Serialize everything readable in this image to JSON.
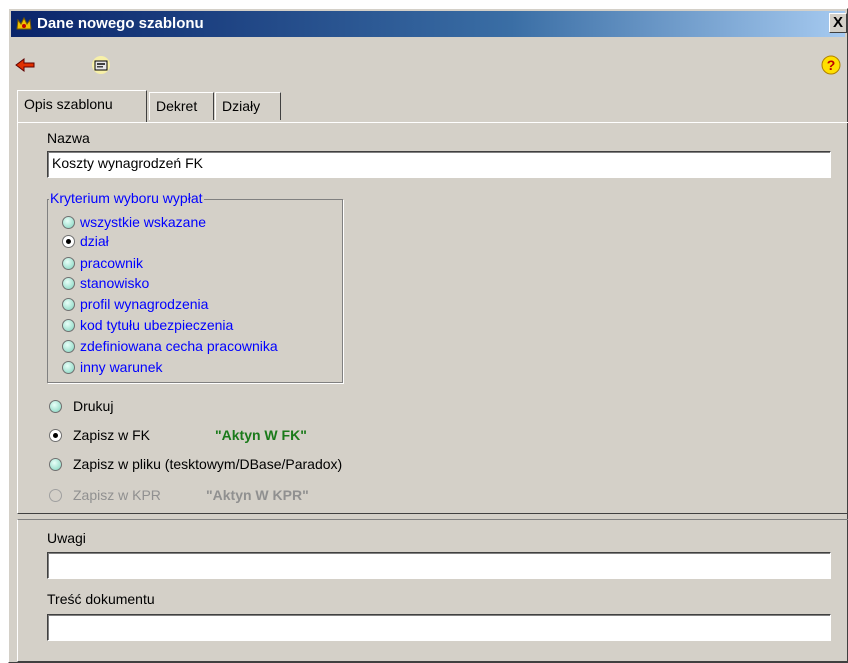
{
  "window": {
    "title": "Dane nowego szablonu",
    "close_label": "X"
  },
  "toolbar": {
    "back_icon": "arrow-left-icon",
    "save_icon": "clipboard-save-icon",
    "help_icon": "help-icon"
  },
  "tabs": [
    {
      "label": "Opis szablonu"
    },
    {
      "label": "Dekret"
    },
    {
      "label": "Działy"
    }
  ],
  "form": {
    "name_label": "Nazwa",
    "name_value": "Koszty wynagrodzeń FK",
    "criteria_legend": "Kryterium wyboru wypłat",
    "criteria": [
      {
        "label": "wszystkie wskazane",
        "checked": false
      },
      {
        "label": "dział",
        "checked": true
      },
      {
        "label": "pracownik",
        "checked": false
      },
      {
        "label": "stanowisko",
        "checked": false
      },
      {
        "label": "profil wynagrodzenia",
        "checked": false
      },
      {
        "label": "kod tytułu ubezpieczenia",
        "checked": false
      },
      {
        "label": "zdefiniowana cecha pracownika",
        "checked": false
      },
      {
        "label": "inny warunek",
        "checked": false
      }
    ],
    "output": [
      {
        "label": "Drukuj",
        "checked": false,
        "enabled": true,
        "note": ""
      },
      {
        "label": "Zapisz w FK",
        "checked": true,
        "enabled": true,
        "note": "\"Aktyn W FK\""
      },
      {
        "label": "Zapisz w pliku (tesktowym/DBase/Paradox)",
        "checked": false,
        "enabled": true,
        "note": ""
      },
      {
        "label": "Zapisz w KPR",
        "checked": false,
        "enabled": false,
        "note": "\"Aktyn W KPR\""
      }
    ],
    "notes_label": "Uwagi",
    "notes_value": "",
    "content_label": "Treść dokumentu",
    "content_value": ""
  },
  "colors": {
    "titlebar_start": "#0a246a",
    "titlebar_end": "#a6caf0",
    "face": "#d4d0c8",
    "group_text": "#0000ff",
    "fk_note": "#1a7a1a",
    "disabled": "#909090"
  }
}
